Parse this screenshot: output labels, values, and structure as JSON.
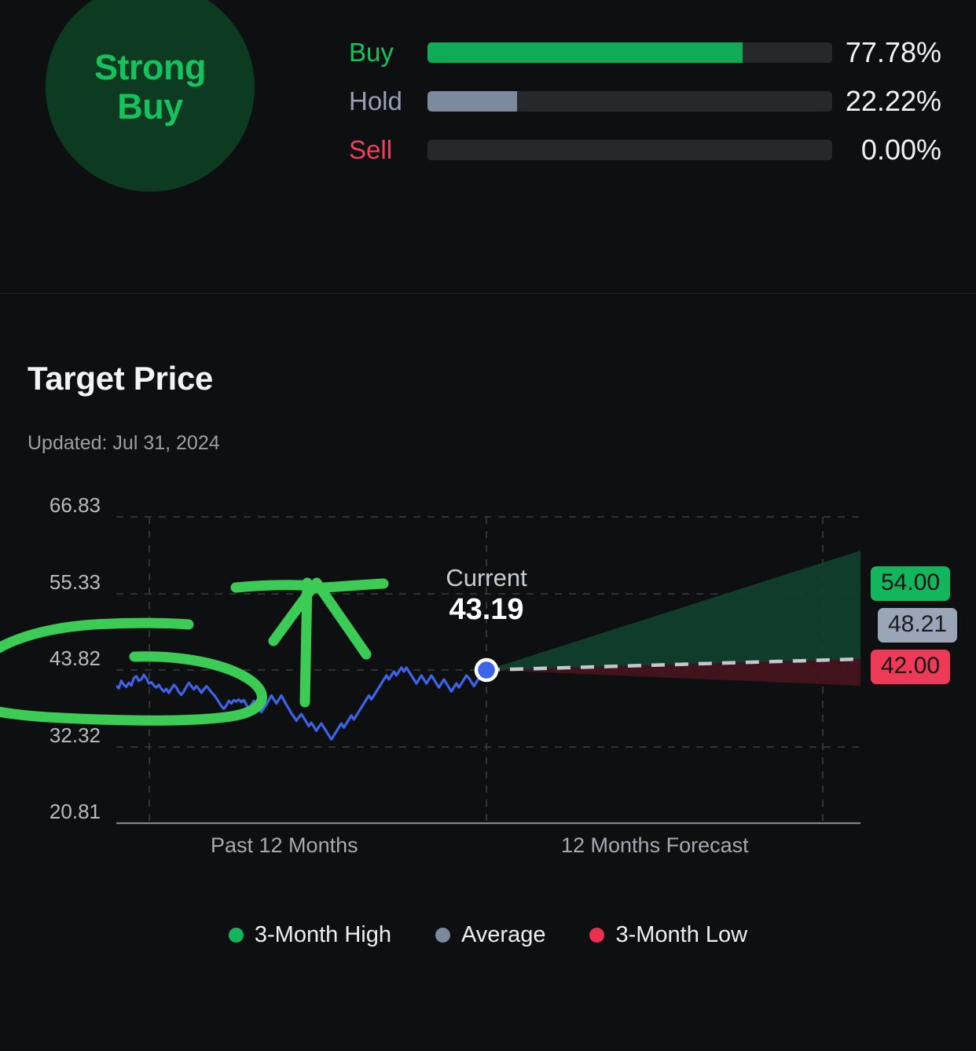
{
  "consensus": {
    "rating_line1": "Strong",
    "rating_line2": "Buy",
    "rows": [
      {
        "label": "Buy",
        "pct_text": "77.78%",
        "pct": 77.78,
        "color": "#11ab56"
      },
      {
        "label": "Hold",
        "pct_text": "22.22%",
        "pct": 22.22,
        "color": "#7d8a9e"
      },
      {
        "label": "Sell",
        "pct_text": "0.00%",
        "pct": 0.0,
        "color": "#ef4060"
      }
    ]
  },
  "target_price": {
    "title": "Target Price",
    "updated": "Updated: Jul 31, 2024",
    "current_label": "Current",
    "current_value": "43.19",
    "badges": {
      "high": "54.00",
      "average": "48.21",
      "low": "42.00"
    },
    "legend": [
      {
        "label": "3-Month High",
        "color": "#12b45c"
      },
      {
        "label": "Average",
        "color": "#7d8a9e"
      },
      {
        "label": "3-Month Low",
        "color": "#ec2f4f"
      }
    ]
  },
  "chart_data": {
    "type": "line",
    "title": "Target Price",
    "subtitle": "Updated: Jul 31, 2024",
    "xlabel": "",
    "ylabel": "",
    "grid": true,
    "legend_position": "bottom",
    "ylim": [
      20.81,
      66.83
    ],
    "ytick_labels": [
      "66.83",
      "55.33",
      "43.82",
      "32.32",
      "20.81"
    ],
    "ytick_values": [
      66.83,
      55.33,
      43.82,
      32.32,
      20.81
    ],
    "xtick_labels": [
      "Past 12 Months",
      "12 Months Forecast"
    ],
    "current_price": 43.19,
    "forecast": {
      "high": 54.0,
      "average": 48.21,
      "low": 42.0
    },
    "series": [
      {
        "name": "Historical Price",
        "color": "#3c63e8",
        "type": "line",
        "values": [
          41.4,
          41.1,
          42.2,
          41.6,
          41.3,
          41.9,
          41.5,
          42.6,
          42.9,
          42.2,
          42.4,
          43.1,
          42.6,
          41.8,
          42.0,
          41.5,
          41.2,
          41.6,
          41.0,
          40.6,
          41.0,
          40.4,
          41.0,
          41.6,
          41.2,
          40.5,
          40.1,
          40.6,
          41.3,
          41.9,
          41.4,
          40.9,
          41.4,
          41.0,
          40.4,
          40.9,
          41.4,
          41.0,
          40.5,
          40.1,
          39.6,
          39.0,
          38.4,
          38.0,
          38.5,
          39.2,
          38.8,
          39.3,
          39.1,
          39.4,
          39.0,
          39.3,
          38.6,
          38.0,
          38.6,
          39.2,
          38.7,
          38.1,
          37.5,
          38.1,
          38.6,
          39.3,
          40.0,
          39.4,
          38.8,
          39.4,
          40.0,
          39.3,
          38.6,
          38.0,
          37.3,
          36.8,
          36.2,
          36.7,
          37.2,
          36.6,
          36.0,
          35.4,
          35.9,
          35.3,
          34.7,
          35.3,
          35.8,
          35.2,
          34.6,
          34.0,
          33.4,
          34.0,
          34.6,
          35.2,
          35.8,
          35.2,
          35.8,
          36.4,
          37.0,
          36.4,
          37.0,
          37.6,
          38.2,
          38.8,
          39.4,
          40.0,
          39.4,
          40.0,
          40.6,
          41.2,
          41.8,
          42.4,
          43.0,
          42.4,
          43.0,
          43.6,
          43.0,
          43.6,
          44.2,
          43.6,
          44.2,
          43.6,
          43.0,
          42.4,
          41.8,
          42.4,
          43.0,
          42.4,
          41.8,
          42.4,
          43.0,
          42.4,
          41.8,
          41.2,
          41.8,
          42.4,
          41.8,
          41.2,
          40.6,
          41.2,
          41.8,
          41.2,
          41.8,
          42.4,
          43.0,
          42.6,
          42.0,
          41.4,
          42.0,
          42.6,
          43.2,
          43.8,
          43.19
        ]
      },
      {
        "name": "Average Forecast",
        "color": "#b9bec5",
        "type": "dashed-line",
        "values": [
          43.19,
          48.21
        ]
      },
      {
        "name": "High Forecast Band",
        "color": "#123b2a",
        "type": "band",
        "values": [
          43.19,
          54.0
        ]
      },
      {
        "name": "Low Forecast Band",
        "color": "#3d1620",
        "type": "band",
        "values": [
          43.19,
          42.0
        ]
      }
    ],
    "annotations": [
      {
        "type": "ellipse-scribble",
        "color": "#33cc55",
        "note": "hand-drawn green oval over left portion of historical line"
      },
      {
        "type": "arrow-scribble",
        "color": "#33cc55",
        "note": "hand-drawn green up arrow mid-chart"
      }
    ]
  }
}
